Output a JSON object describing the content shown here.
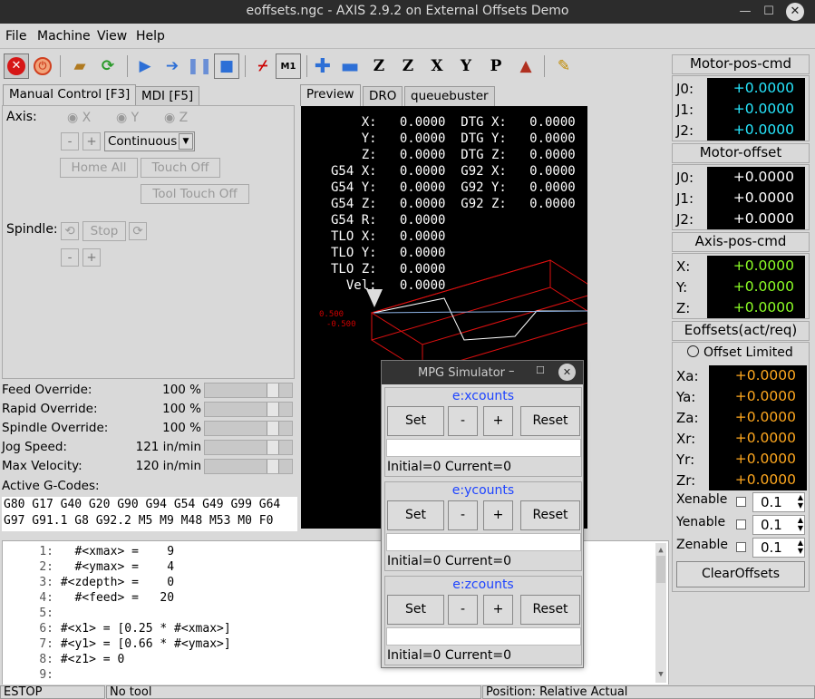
{
  "window": {
    "title": "eoffsets.ngc - AXIS 2.9.2 on External Offsets Demo"
  },
  "menu": [
    "File",
    "Machine",
    "View",
    "Help"
  ],
  "left_tabs": [
    "Manual Control [F3]",
    "MDI [F5]"
  ],
  "manual": {
    "axis_label": "Axis:",
    "axes": [
      "X",
      "Y",
      "Z"
    ],
    "minus": "-",
    "plus": "+",
    "jog_mode": "Continuous",
    "home_all": "Home All",
    "touch_off": "Touch Off",
    "tool_touch_off": "Tool Touch Off",
    "spindle_label": "Spindle:",
    "stop": "Stop"
  },
  "overrides": [
    {
      "label": "Feed Override:",
      "value": "100 %"
    },
    {
      "label": "Rapid Override:",
      "value": "100 %"
    },
    {
      "label": "Spindle Override:",
      "value": "100 %"
    },
    {
      "label": "Jog Speed:",
      "value": "121 in/min"
    },
    {
      "label": "Max Velocity:",
      "value": "120 in/min"
    }
  ],
  "gcodes": {
    "label": "Active G-Codes:",
    "line1": "G80 G17 G40 G20 G90 G94 G54 G49 G99 G64",
    "line2": "G97 G91.1 G8 G92.2 M5 M9 M48 M53 M0 F0"
  },
  "preview_tabs": [
    "Preview",
    "DRO",
    "queuebuster"
  ],
  "dro": [
    "    X:   0.0000  DTG X:   0.0000",
    "    Y:   0.0000  DTG Y:   0.0000",
    "    Z:   0.0000  DTG Z:   0.0000",
    "G54 X:   0.0000  G92 X:   0.0000",
    "G54 Y:   0.0000  G92 Y:   0.0000",
    "G54 Z:   0.0000  G92 Z:   0.0000",
    "G54 R:   0.0000",
    "TLO X:   0.0000",
    "TLO Y:   0.0000",
    "TLO Z:   0.0000",
    "  Vel:   0.0000"
  ],
  "code_lines": [
    {
      "n": "1:",
      "t": "  #<xmax> =    9"
    },
    {
      "n": "2:",
      "t": "  #<ymax> =    4"
    },
    {
      "n": "3:",
      "t": "#<zdepth> =    0"
    },
    {
      "n": "4:",
      "t": "  #<feed> =   20"
    },
    {
      "n": "5:",
      "t": ""
    },
    {
      "n": "6:",
      "t": "#<x1> = [0.25 * #<xmax>]"
    },
    {
      "n": "7:",
      "t": "#<y1> = [0.66 * #<ymax>]"
    },
    {
      "n": "8:",
      "t": "#<z1> = 0"
    },
    {
      "n": "9:",
      "t": ""
    }
  ],
  "status": {
    "estop": "ESTOP",
    "tool": "No tool",
    "position": "Position: Relative Actual"
  },
  "right": {
    "motor_pos_cmd": {
      "title": "Motor-pos-cmd",
      "rows": [
        {
          "k": "J0:",
          "v": "+0.0000"
        },
        {
          "k": "J1:",
          "v": "+0.0000"
        },
        {
          "k": "J2:",
          "v": "+0.0000"
        }
      ]
    },
    "motor_offset": {
      "title": "Motor-offset",
      "rows": [
        {
          "k": "J0:",
          "v": "+0.0000"
        },
        {
          "k": "J1:",
          "v": "+0.0000"
        },
        {
          "k": "J2:",
          "v": "+0.0000"
        }
      ]
    },
    "axis_pos_cmd": {
      "title": "Axis-pos-cmd",
      "rows": [
        {
          "k": "X:",
          "v": "+0.0000"
        },
        {
          "k": "Y:",
          "v": "+0.0000"
        },
        {
          "k": "Z:",
          "v": "+0.0000"
        }
      ]
    },
    "eoffsets": {
      "title": "Eoffsets(act/req)",
      "limited": "Offset Limited",
      "rows": [
        {
          "k": "Xa:",
          "v": "+0.0000"
        },
        {
          "k": "Ya:",
          "v": "+0.0000"
        },
        {
          "k": "Za:",
          "v": "+0.0000"
        },
        {
          "k": "Xr:",
          "v": "+0.0000"
        },
        {
          "k": "Yr:",
          "v": "+0.0000"
        },
        {
          "k": "Zr:",
          "v": "+0.0000"
        }
      ]
    },
    "enables": [
      {
        "label": "Xenable",
        "value": "0.1"
      },
      {
        "label": "Yenable",
        "value": "0.1"
      },
      {
        "label": "Zenable",
        "value": "0.1"
      }
    ],
    "clear": "ClearOffsets"
  },
  "mpg": {
    "title": "MPG Simulator",
    "groups": [
      {
        "name": "e:xcounts",
        "set": "Set",
        "minus": "-",
        "plus": "+",
        "reset": "Reset",
        "info": "Initial=0 Current=0"
      },
      {
        "name": "e:ycounts",
        "set": "Set",
        "minus": "-",
        "plus": "+",
        "reset": "Reset",
        "info": "Initial=0 Current=0"
      },
      {
        "name": "e:zcounts",
        "set": "Set",
        "minus": "-",
        "plus": "+",
        "reset": "Reset",
        "info": "Initial=0 Current=0"
      }
    ]
  },
  "preview_labels": {
    "a": "0.500",
    "b": "-0.500"
  }
}
